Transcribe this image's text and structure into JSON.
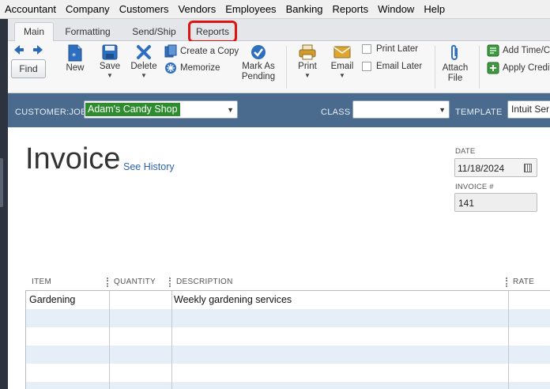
{
  "menu": [
    "Accountant",
    "Company",
    "Customers",
    "Vendors",
    "Employees",
    "Banking",
    "Reports",
    "Window",
    "Help"
  ],
  "tabs": {
    "main": "Main",
    "formatting": "Formatting",
    "send_ship": "Send/Ship",
    "reports": "Reports"
  },
  "toolbar": {
    "find": "Find",
    "new": "New",
    "save": "Save",
    "delete": "Delete",
    "create_copy": "Create a Copy",
    "memorize": "Memorize",
    "mark_pending_1": "Mark As",
    "mark_pending_2": "Pending",
    "print": "Print",
    "email": "Email",
    "print_later": "Print Later",
    "email_later": "Email Later",
    "attach_1": "Attach",
    "attach_2": "File",
    "add_time": "Add Time/C",
    "apply_credit": "Apply Credit"
  },
  "customer_bar": {
    "customer_label": "CUSTOMER:JOB",
    "customer_value": "Adam's Candy Shop",
    "class_label": "CLASS",
    "class_value": "",
    "template_label": "TEMPLATE",
    "template_value": "Intuit Ser"
  },
  "invoice": {
    "title": "Invoice",
    "see_history": "See History",
    "date_label": "DATE",
    "date_value": "11/18/2024",
    "number_label": "INVOICE #",
    "number_value": "141"
  },
  "table": {
    "headers": {
      "item": "ITEM",
      "quantity": "QUANTITY",
      "description": "DESCRIPTION",
      "rate": "RATE"
    },
    "rows": [
      {
        "item": "Gardening",
        "quantity": "",
        "description": "Weekly gardening services",
        "rate": ""
      }
    ]
  },
  "colors": {
    "customer_bar": "#4a6b8e",
    "customer_highlight": "#2e8b2e",
    "reports_tab_outline": "#e01313",
    "link": "#2b63b0",
    "row_alt": "#e6eef8"
  }
}
